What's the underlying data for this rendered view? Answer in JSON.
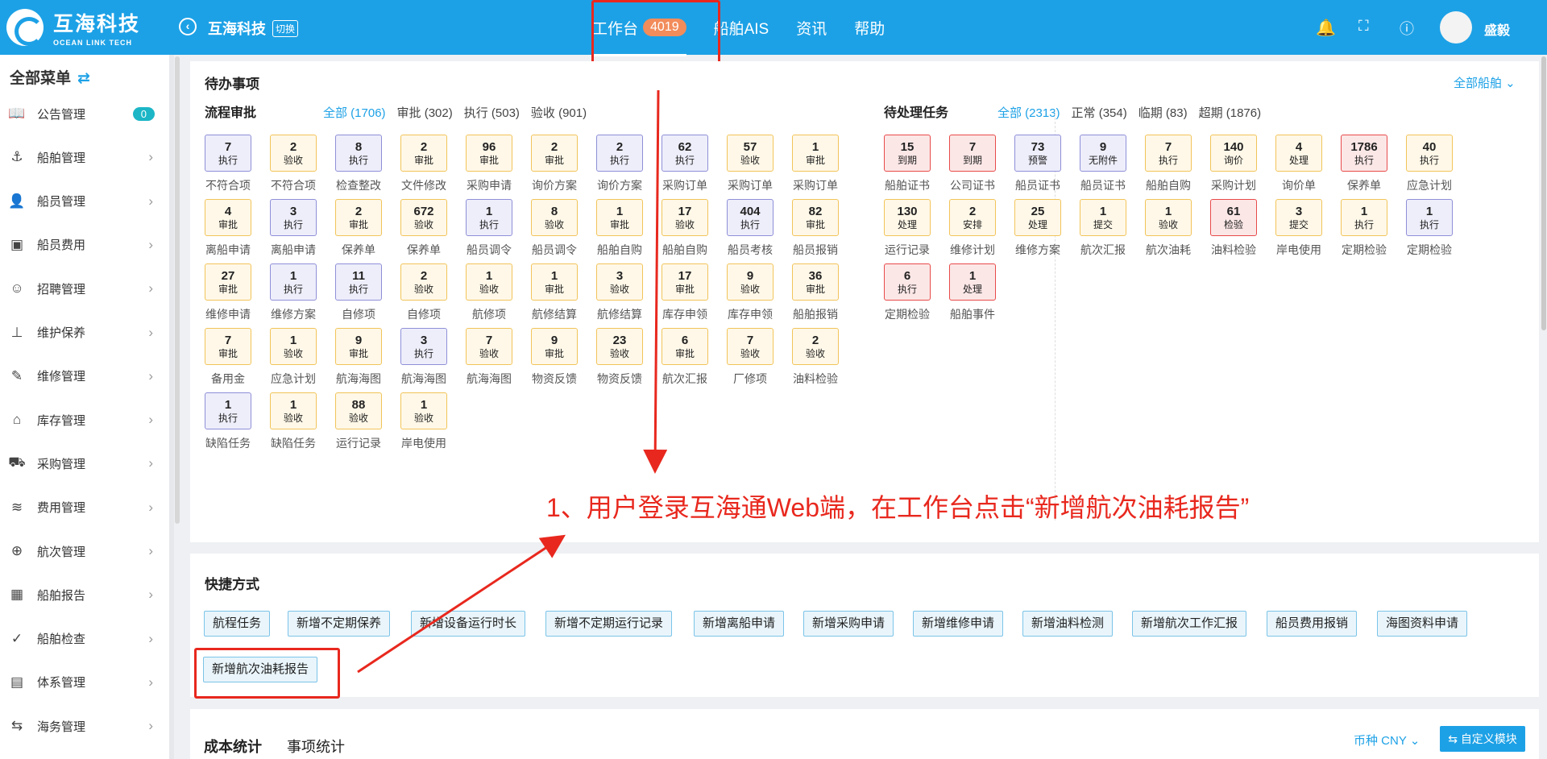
{
  "header": {
    "logo_cn": "互海科技",
    "logo_en": "OCEAN LINK TECH",
    "company": "互海科技",
    "switch": "切换",
    "nav": [
      {
        "label": "工作台",
        "badge": "4019",
        "active": true
      },
      {
        "label": "船舶AIS"
      },
      {
        "label": "资讯"
      },
      {
        "label": "帮助"
      }
    ],
    "user": "盛毅"
  },
  "sidebar": {
    "title": "全部菜单",
    "items": [
      {
        "label": "公告管理",
        "icon": "book-icon",
        "badge": "0"
      },
      {
        "label": "船舶管理",
        "icon": "anchor-icon"
      },
      {
        "label": "船员管理",
        "icon": "person-icon"
      },
      {
        "label": "船员费用",
        "icon": "wallet-icon"
      },
      {
        "label": "招聘管理",
        "icon": "recruit-icon"
      },
      {
        "label": "维护保养",
        "icon": "tool-icon"
      },
      {
        "label": "维修管理",
        "icon": "wrench-icon"
      },
      {
        "label": "库存管理",
        "icon": "home-icon"
      },
      {
        "label": "采购管理",
        "icon": "cart-icon"
      },
      {
        "label": "费用管理",
        "icon": "database-icon"
      },
      {
        "label": "航次管理",
        "icon": "globe-icon"
      },
      {
        "label": "船舶报告",
        "icon": "calendar-icon"
      },
      {
        "label": "船舶检查",
        "icon": "check-circle-icon"
      },
      {
        "label": "体系管理",
        "icon": "document-icon"
      },
      {
        "label": "海务管理",
        "icon": "signpost-icon"
      }
    ]
  },
  "todo": {
    "title": "待办事项",
    "all_ships": "全部船舶",
    "workflow": {
      "title": "流程审批",
      "filters": [
        "全部 (1706)",
        "审批 (302)",
        "执行 (503)",
        "验收 (901)"
      ],
      "rows": [
        [
          [
            "7",
            "执行",
            "不符合项",
            "p"
          ],
          [
            "2",
            "验收",
            "不符合项",
            "y"
          ],
          [
            "8",
            "执行",
            "检查整改",
            "p"
          ],
          [
            "2",
            "审批",
            "文件修改",
            "y"
          ],
          [
            "96",
            "审批",
            "采购申请",
            "y"
          ],
          [
            "2",
            "审批",
            "询价方案",
            "y"
          ],
          [
            "2",
            "执行",
            "询价方案",
            "p"
          ],
          [
            "62",
            "执行",
            "采购订单",
            "p"
          ],
          [
            "57",
            "验收",
            "采购订单",
            "y"
          ],
          [
            "1",
            "审批",
            "采购订单",
            "y"
          ]
        ],
        [
          [
            "4",
            "审批",
            "离船申请",
            "y"
          ],
          [
            "3",
            "执行",
            "离船申请",
            "p"
          ],
          [
            "2",
            "审批",
            "保养单",
            "y"
          ],
          [
            "672",
            "验收",
            "保养单",
            "y"
          ],
          [
            "1",
            "执行",
            "船员调令",
            "p"
          ],
          [
            "8",
            "验收",
            "船员调令",
            "y"
          ],
          [
            "1",
            "审批",
            "船舶自购",
            "y"
          ],
          [
            "17",
            "验收",
            "船舶自购",
            "y"
          ],
          [
            "404",
            "执行",
            "船员考核",
            "p"
          ],
          [
            "82",
            "审批",
            "船员报销",
            "y"
          ]
        ],
        [
          [
            "27",
            "审批",
            "维修申请",
            "y"
          ],
          [
            "1",
            "执行",
            "维修方案",
            "p"
          ],
          [
            "11",
            "执行",
            "自修项",
            "p"
          ],
          [
            "2",
            "验收",
            "自修项",
            "y"
          ],
          [
            "1",
            "验收",
            "航修项",
            "y"
          ],
          [
            "1",
            "审批",
            "航修结算",
            "y"
          ],
          [
            "3",
            "验收",
            "航修结算",
            "y"
          ],
          [
            "17",
            "审批",
            "库存申领",
            "y"
          ],
          [
            "9",
            "验收",
            "库存申领",
            "y"
          ],
          [
            "36",
            "审批",
            "船舶报销",
            "y"
          ]
        ],
        [
          [
            "7",
            "审批",
            "备用金",
            "y"
          ],
          [
            "1",
            "验收",
            "应急计划",
            "y"
          ],
          [
            "9",
            "审批",
            "航海海图",
            "y"
          ],
          [
            "3",
            "执行",
            "航海海图",
            "p"
          ],
          [
            "7",
            "验收",
            "航海海图",
            "y"
          ],
          [
            "9",
            "审批",
            "物资反馈",
            "y"
          ],
          [
            "23",
            "验收",
            "物资反馈",
            "y"
          ],
          [
            "6",
            "审批",
            "航次汇报",
            "y"
          ],
          [
            "7",
            "验收",
            "厂修项",
            "y"
          ],
          [
            "2",
            "验收",
            "油料检验",
            "y"
          ]
        ],
        [
          [
            "1",
            "执行",
            "缺陷任务",
            "p"
          ],
          [
            "1",
            "验收",
            "缺陷任务",
            "y"
          ],
          [
            "88",
            "验收",
            "运行记录",
            "y"
          ],
          [
            "1",
            "验收",
            "岸电使用",
            "y"
          ]
        ]
      ]
    },
    "pending": {
      "title": "待处理任务",
      "filters": [
        "全部 (2313)",
        "正常 (354)",
        "临期 (83)",
        "超期 (1876)"
      ],
      "rows": [
        [
          [
            "15",
            "到期",
            "船舶证书",
            "r"
          ],
          [
            "7",
            "到期",
            "公司证书",
            "r"
          ],
          [
            "73",
            "预警",
            "船员证书",
            "p"
          ],
          [
            "9",
            "无附件",
            "船员证书",
            "p"
          ],
          [
            "7",
            "执行",
            "船舶自购",
            "y"
          ],
          [
            "140",
            "询价",
            "采购计划",
            "y"
          ],
          [
            "4",
            "处理",
            "询价单",
            "y"
          ],
          [
            "1786",
            "执行",
            "保养单",
            "r"
          ],
          [
            "40",
            "执行",
            "应急计划",
            "y"
          ]
        ],
        [
          [
            "130",
            "处理",
            "运行记录",
            "y"
          ],
          [
            "2",
            "安排",
            "维修计划",
            "y"
          ],
          [
            "25",
            "处理",
            "维修方案",
            "y"
          ],
          [
            "1",
            "提交",
            "航次汇报",
            "y"
          ],
          [
            "1",
            "验收",
            "航次油耗",
            "y"
          ],
          [
            "61",
            "检验",
            "油料检验",
            "r"
          ],
          [
            "3",
            "提交",
            "岸电使用",
            "y"
          ],
          [
            "1",
            "执行",
            "定期检验",
            "y"
          ],
          [
            "1",
            "执行",
            "定期检验",
            "p"
          ]
        ],
        [
          [
            "6",
            "执行",
            "定期检验",
            "r"
          ],
          [
            "1",
            "处理",
            "船舶事件",
            "r"
          ]
        ]
      ]
    }
  },
  "annotation": "1、用户登录互海通Web端，在工作台点击“新增航次油耗报告”",
  "shortcuts": {
    "title": "快捷方式",
    "buttons": [
      "航程任务",
      "新增不定期保养",
      "新增设备运行时长",
      "新增不定期运行记录",
      "新增离船申请",
      "新增采购申请",
      "新增维修申请",
      "新增油料检测",
      "新增航次工作汇报",
      "船员费用报销",
      "海图资料申请",
      "新增航次油耗报告"
    ]
  },
  "stats": {
    "tabs": [
      "成本统计",
      "事项统计"
    ],
    "currency": "币种 CNY",
    "custom": "自定义模块"
  },
  "colors": {
    "primary": "#1da1e6",
    "annotation": "#e8281e",
    "yellow_border": "#f2c45a",
    "purple_border": "#8f8fd8",
    "red_border": "#e84a4a"
  }
}
